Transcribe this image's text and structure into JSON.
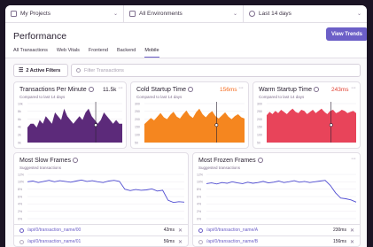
{
  "filters": {
    "project": "My Projects",
    "environment": "All Environments",
    "period": "Last 14 days"
  },
  "header": {
    "title": "Performance",
    "view_trends": "View Trends"
  },
  "tabs": [
    "All Transactions",
    "Web Vitals",
    "Frontend",
    "Backend",
    "Mobile"
  ],
  "active_tab": "Mobile",
  "search": {
    "filters_label": "2 Active Filters",
    "placeholder": "Filter Transactions"
  },
  "cards": {
    "tpm": {
      "title": "Transactions Per Minute",
      "subtitle": "Compared to last 14 days",
      "value": "11.5k",
      "value_color": "#2b2233"
    },
    "cold": {
      "title": "Cold Startup Time",
      "subtitle": "Compared to last 14 days",
      "value": "156ms",
      "value_color": "#f56b1f"
    },
    "warm": {
      "title": "Warm Startup Time",
      "subtitle": "Compared to last 14 days",
      "value": "243ms",
      "value_color": "#e03e2f"
    },
    "slow": {
      "title": "Most Slow Frames",
      "subtitle": "Suggested transactions"
    },
    "frozen": {
      "title": "Most Frozen Frames",
      "subtitle": "Suggested transactions"
    }
  },
  "lists": {
    "slow": [
      {
        "name": "/api/0/transaction_name/00",
        "value": "42ms"
      },
      {
        "name": "/api/0/transaction_name/01",
        "value": "56ms"
      }
    ],
    "frozen": [
      {
        "name": "/api/0/transaction_name/A",
        "value": "230ms"
      },
      {
        "name": "/api/0/transaction_name/B",
        "value": "156ms"
      }
    ]
  },
  "chart_data": [
    {
      "type": "area",
      "name": "Transactions Per Minute",
      "color": "#5c2a7a",
      "y_ticks": [
        "10k",
        "8k",
        "6k",
        "4k",
        "2k",
        "0k"
      ],
      "values": [
        4,
        5,
        5,
        4,
        6,
        5,
        7,
        6,
        5,
        8,
        7,
        6,
        9,
        7,
        6,
        5,
        6,
        7,
        6,
        8,
        9,
        7,
        6,
        5,
        6,
        8,
        7,
        6,
        5,
        6,
        5,
        5
      ]
    },
    {
      "type": "area",
      "name": "Cold Startup Time",
      "color": "#f5861f",
      "y_ticks": [
        "300",
        "250",
        "200",
        "150",
        "100",
        "50"
      ],
      "values": [
        3,
        3.5,
        4,
        3.6,
        4.2,
        4.8,
        4.1,
        3.8,
        4.5,
        5,
        4.2,
        3.9,
        4.6,
        5.2,
        4.4,
        4,
        4.9,
        5.5,
        4.6,
        4.1,
        4.7,
        5.1,
        4.3,
        3.9,
        4.4,
        4.9,
        4.2,
        3.8,
        4.3,
        4.6,
        4.1,
        3.9
      ]
    },
    {
      "type": "area",
      "name": "Warm Startup Time",
      "color": "#e8445a",
      "y_ticks": [
        "300",
        "250",
        "200",
        "150",
        "100",
        "50"
      ],
      "values": [
        2.5,
        2.8,
        2.6,
        2.9,
        2.7,
        3,
        2.8,
        2.6,
        2.9,
        3.1,
        2.8,
        2.7,
        3,
        2.9,
        2.6,
        2.8,
        3,
        2.7,
        2.9,
        3.1,
        2.8,
        2.6,
        2.9,
        3,
        2.7,
        2.8,
        3,
        2.9,
        2.7,
        2.8,
        2.9,
        2.7
      ]
    },
    {
      "type": "line",
      "name": "Most Slow Frames",
      "color": "#4e4bd1",
      "y_ticks": [
        "12%",
        "10%",
        "8%",
        "6%",
        "4%",
        "2%",
        "0%"
      ],
      "values": [
        10,
        10.2,
        9.8,
        10.1,
        10.4,
        10,
        10.3,
        10.1,
        9.9,
        10.2,
        10.5,
        10.1,
        10.3,
        10,
        9.8,
        10.2,
        10.4,
        10.1,
        8,
        7.6,
        7.9,
        7.7,
        7.8,
        8.1,
        7.5,
        7.7,
        5,
        4.4,
        4.6,
        4.5
      ]
    },
    {
      "type": "line",
      "name": "Most Frozen Frames",
      "color": "#4e4bd1",
      "y_ticks": [
        "12%",
        "10%",
        "8%",
        "6%",
        "4%",
        "2%",
        "0%"
      ],
      "values": [
        9.5,
        9.7,
        9.4,
        9.8,
        9.6,
        10,
        9.7,
        9.5,
        9.9,
        9.6,
        9.8,
        10.1,
        9.7,
        9.9,
        10.2,
        9.8,
        10,
        10.3,
        9.9,
        10.1,
        9.8,
        10,
        10.2,
        10.4,
        9,
        7,
        5.6,
        5.4,
        5.1,
        4.5
      ]
    }
  ]
}
